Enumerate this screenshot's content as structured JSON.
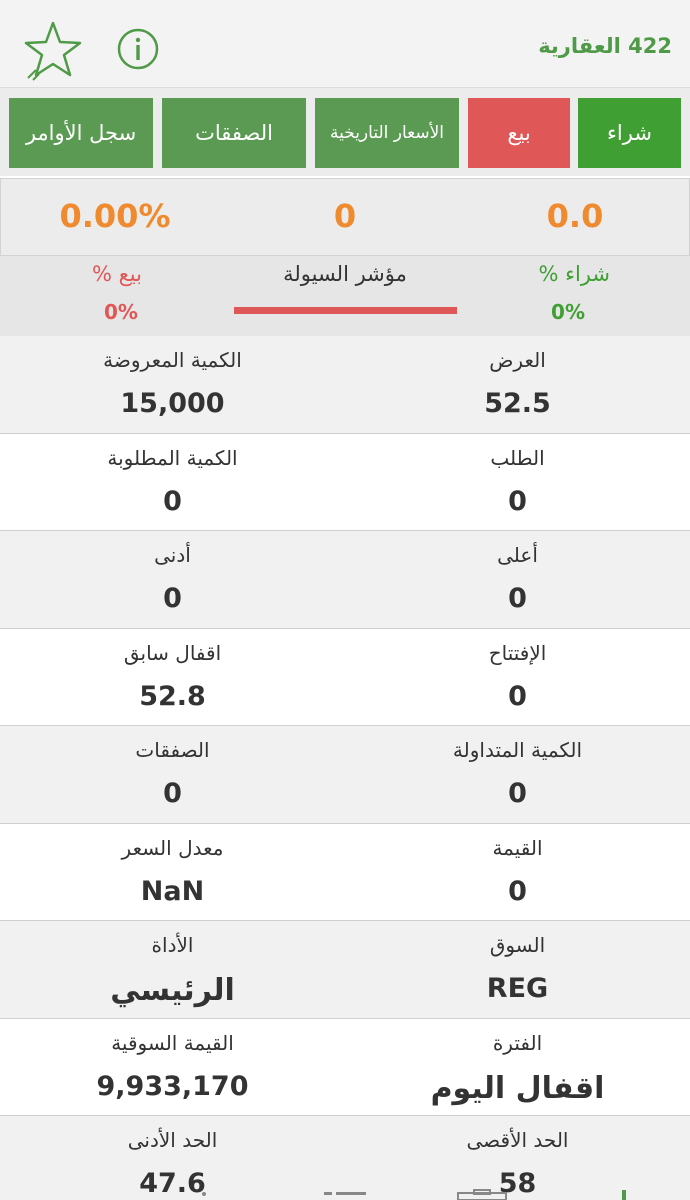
{
  "header": {
    "title": "422 العقارية",
    "star_icon": "star-icon",
    "info_icon": "info-icon",
    "accent": "#4f9a47"
  },
  "buttons": {
    "orders_log": "سجل الأوامر",
    "trades": "الصفقات",
    "historical_prices": "الأسعار التاريخية",
    "sell": "بيع",
    "buy": "شراء"
  },
  "summary": {
    "left": "0.00%",
    "middle": "0",
    "right": "0.0"
  },
  "liquidity": {
    "title": "مؤشر السيولة",
    "buy_label": "شراء %",
    "buy_value": "0%",
    "sell_label": "بيع %",
    "sell_value": "0%"
  },
  "rows": [
    {
      "right_label": "العرض",
      "right_value": "52.5",
      "left_label": "الكمية المعروضة",
      "left_value": "15,000"
    },
    {
      "right_label": "الطلب",
      "right_value": "0",
      "left_label": "الكمية المطلوبة",
      "left_value": "0"
    },
    {
      "right_label": "أعلى",
      "right_value": "0",
      "left_label": "أدنى",
      "left_value": "0"
    },
    {
      "right_label": "الإفتتاح",
      "right_value": "0",
      "left_label": "اقفال سابق",
      "left_value": "52.8"
    },
    {
      "right_label": "الكمية المتداولة",
      "right_value": "0",
      "left_label": "الصفقات",
      "left_value": "0"
    },
    {
      "right_label": "القيمة",
      "right_value": "0",
      "left_label": "معدل السعر",
      "left_value": "NaN"
    },
    {
      "right_label": "السوق",
      "right_value": "REG",
      "left_label": "الأداة",
      "left_value": "الرئيسي"
    },
    {
      "right_label": "الفترة",
      "right_value": "اقفال اليوم",
      "left_label": "القيمة السوقية",
      "left_value": "9,933,170"
    },
    {
      "right_label": "الحد الأقصى",
      "right_value": "58",
      "left_label": "الحد الأدنى",
      "left_value": "47.6"
    }
  ]
}
